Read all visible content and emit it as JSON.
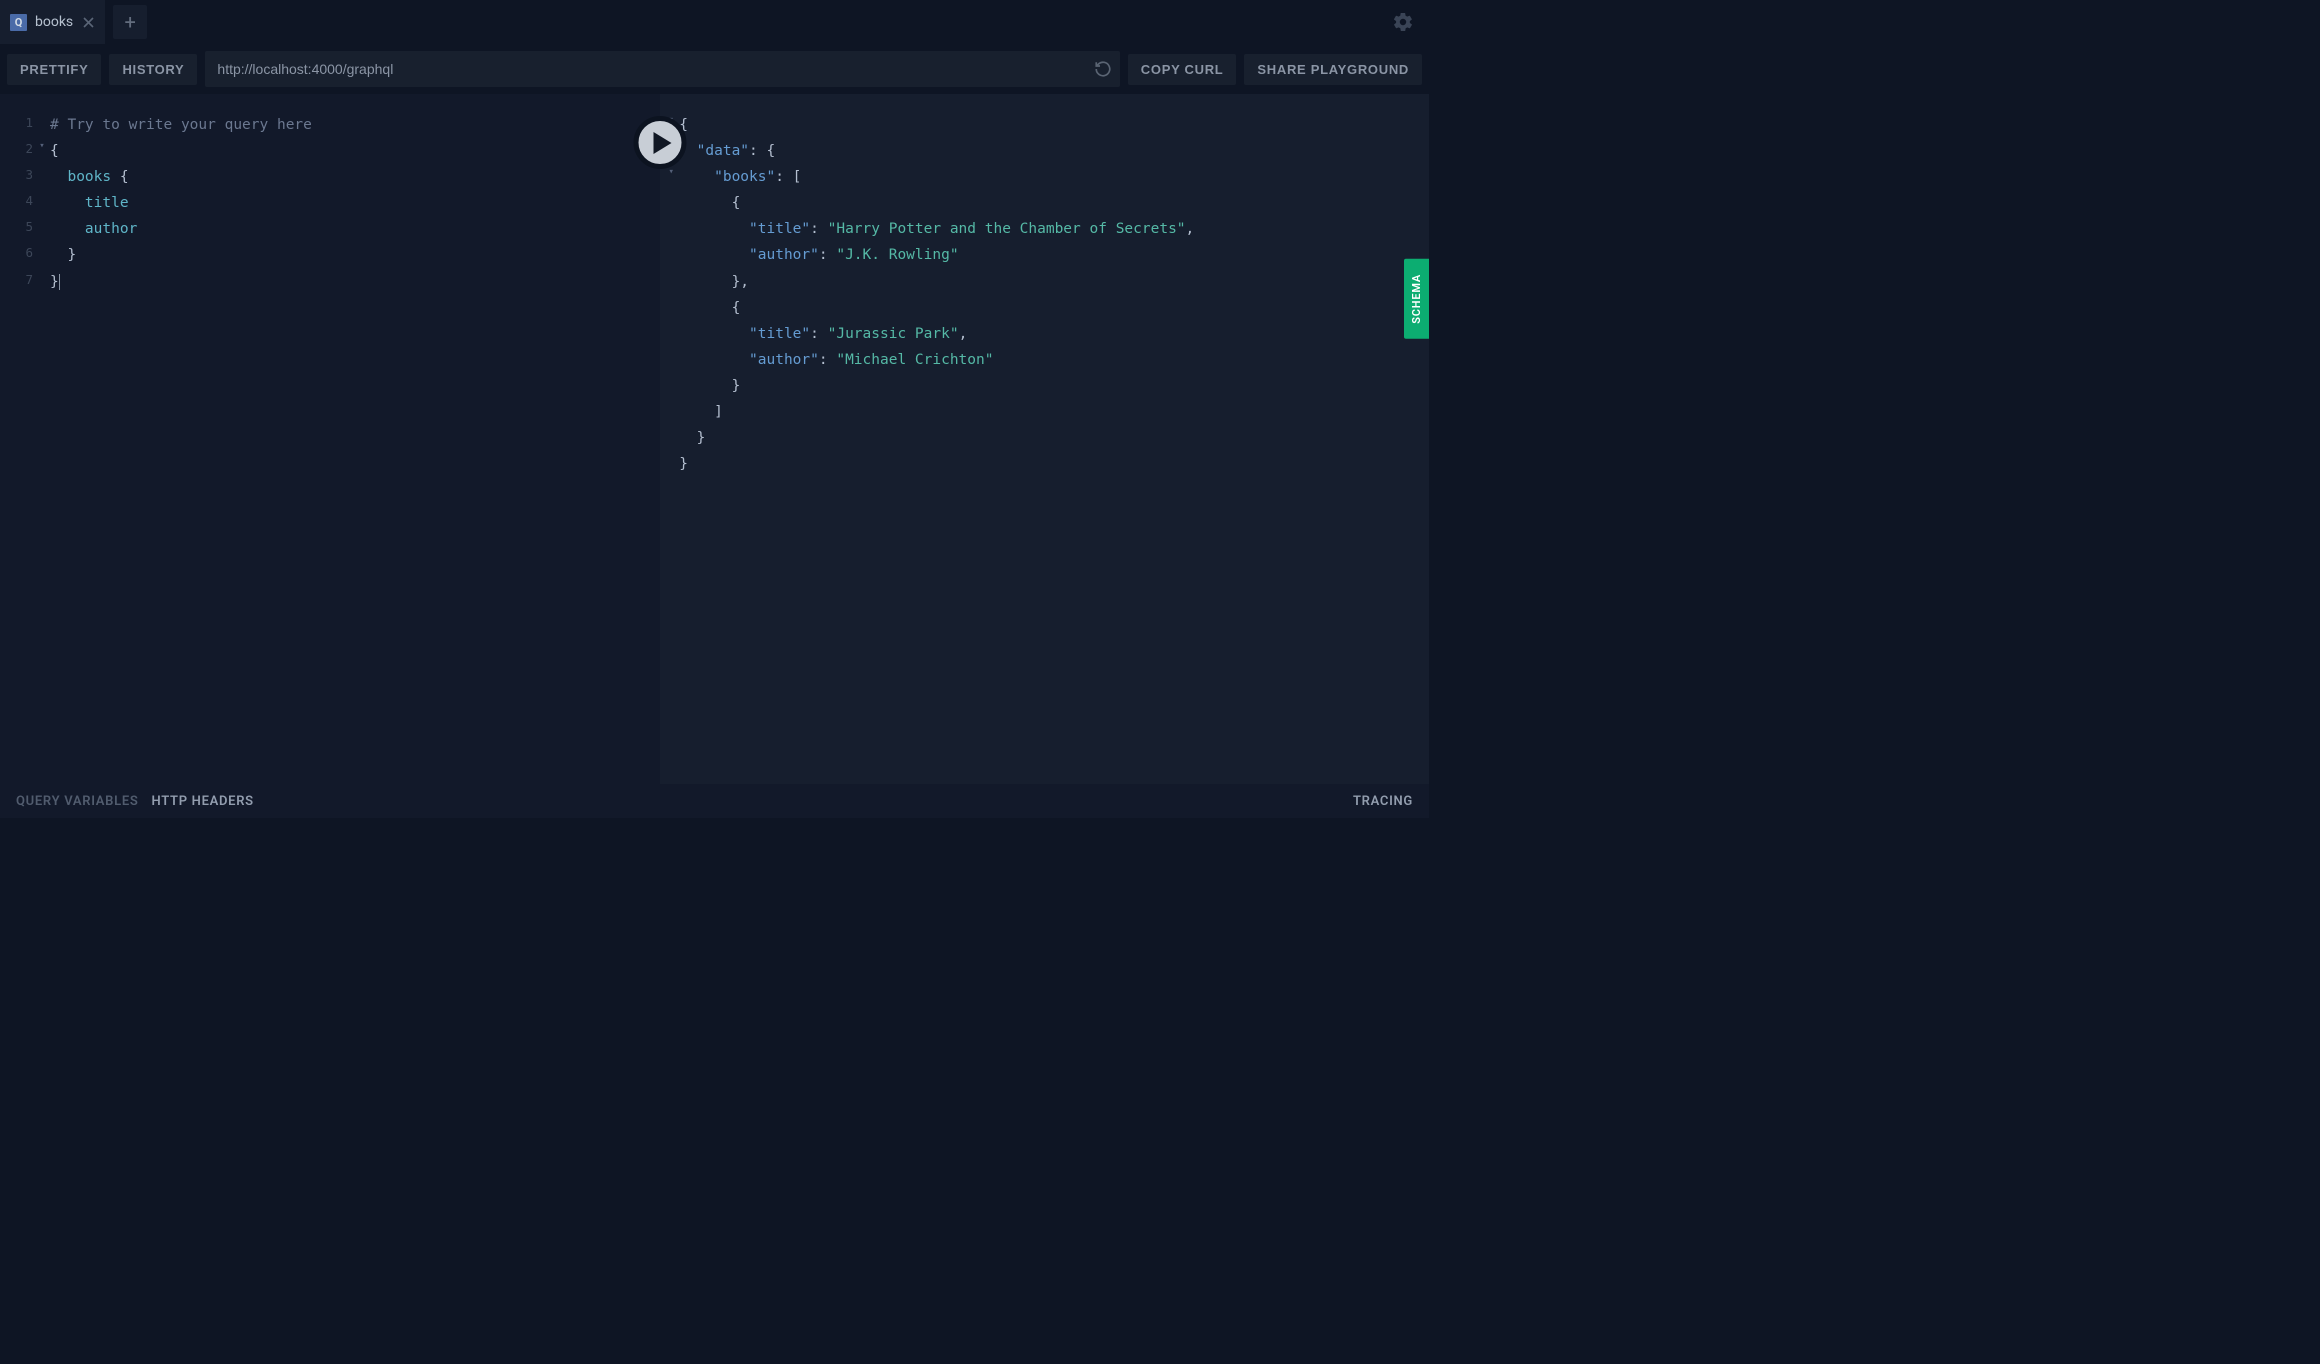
{
  "tab": {
    "icon": "Q",
    "label": "books"
  },
  "toolbar": {
    "prettify": "PRETTIFY",
    "history": "HISTORY",
    "url": "http://localhost:4000/graphql",
    "copy_curl": "COPY CURL",
    "share": "SHARE PLAYGROUND"
  },
  "editor": {
    "lines": [
      {
        "n": "1",
        "comment": "# Try to write your query here"
      },
      {
        "n": "2",
        "fold": true,
        "brace": "{"
      },
      {
        "n": "3",
        "indent": "  ",
        "field": "books",
        "brace": " {"
      },
      {
        "n": "4",
        "indent": "    ",
        "field": "title"
      },
      {
        "n": "5",
        "indent": "    ",
        "field": "author"
      },
      {
        "n": "6",
        "indent": "  ",
        "brace": "}"
      },
      {
        "n": "7",
        "brace": "}",
        "cursor": true
      }
    ]
  },
  "result": {
    "lines": [
      {
        "fold": true,
        "indent": "",
        "prefix": "{",
        "text": ""
      },
      {
        "fold": true,
        "indent": "  ",
        "key": "\"data\"",
        "after": ": {"
      },
      {
        "fold": true,
        "indent": "    ",
        "key": "\"books\"",
        "after": ": ["
      },
      {
        "indent": "      ",
        "text": "{"
      },
      {
        "indent": "        ",
        "key": "\"title\"",
        "mid": ": ",
        "str": "\"Harry Potter and the Chamber of Secrets\"",
        "end": ","
      },
      {
        "indent": "        ",
        "key": "\"author\"",
        "mid": ": ",
        "str": "\"J.K. Rowling\""
      },
      {
        "indent": "      ",
        "text": "},"
      },
      {
        "indent": "      ",
        "text": "{"
      },
      {
        "indent": "        ",
        "key": "\"title\"",
        "mid": ": ",
        "str": "\"Jurassic Park\"",
        "end": ","
      },
      {
        "indent": "        ",
        "key": "\"author\"",
        "mid": ": ",
        "str": "\"Michael Crichton\""
      },
      {
        "indent": "      ",
        "text": "}"
      },
      {
        "indent": "    ",
        "text": "]"
      },
      {
        "indent": "  ",
        "text": "}"
      },
      {
        "indent": "",
        "text": "}"
      }
    ]
  },
  "schema_tab": "SCHEMA",
  "bottom": {
    "query_vars": "QUERY VARIABLES",
    "http_headers": "HTTP HEADERS",
    "tracing": "TRACING"
  }
}
